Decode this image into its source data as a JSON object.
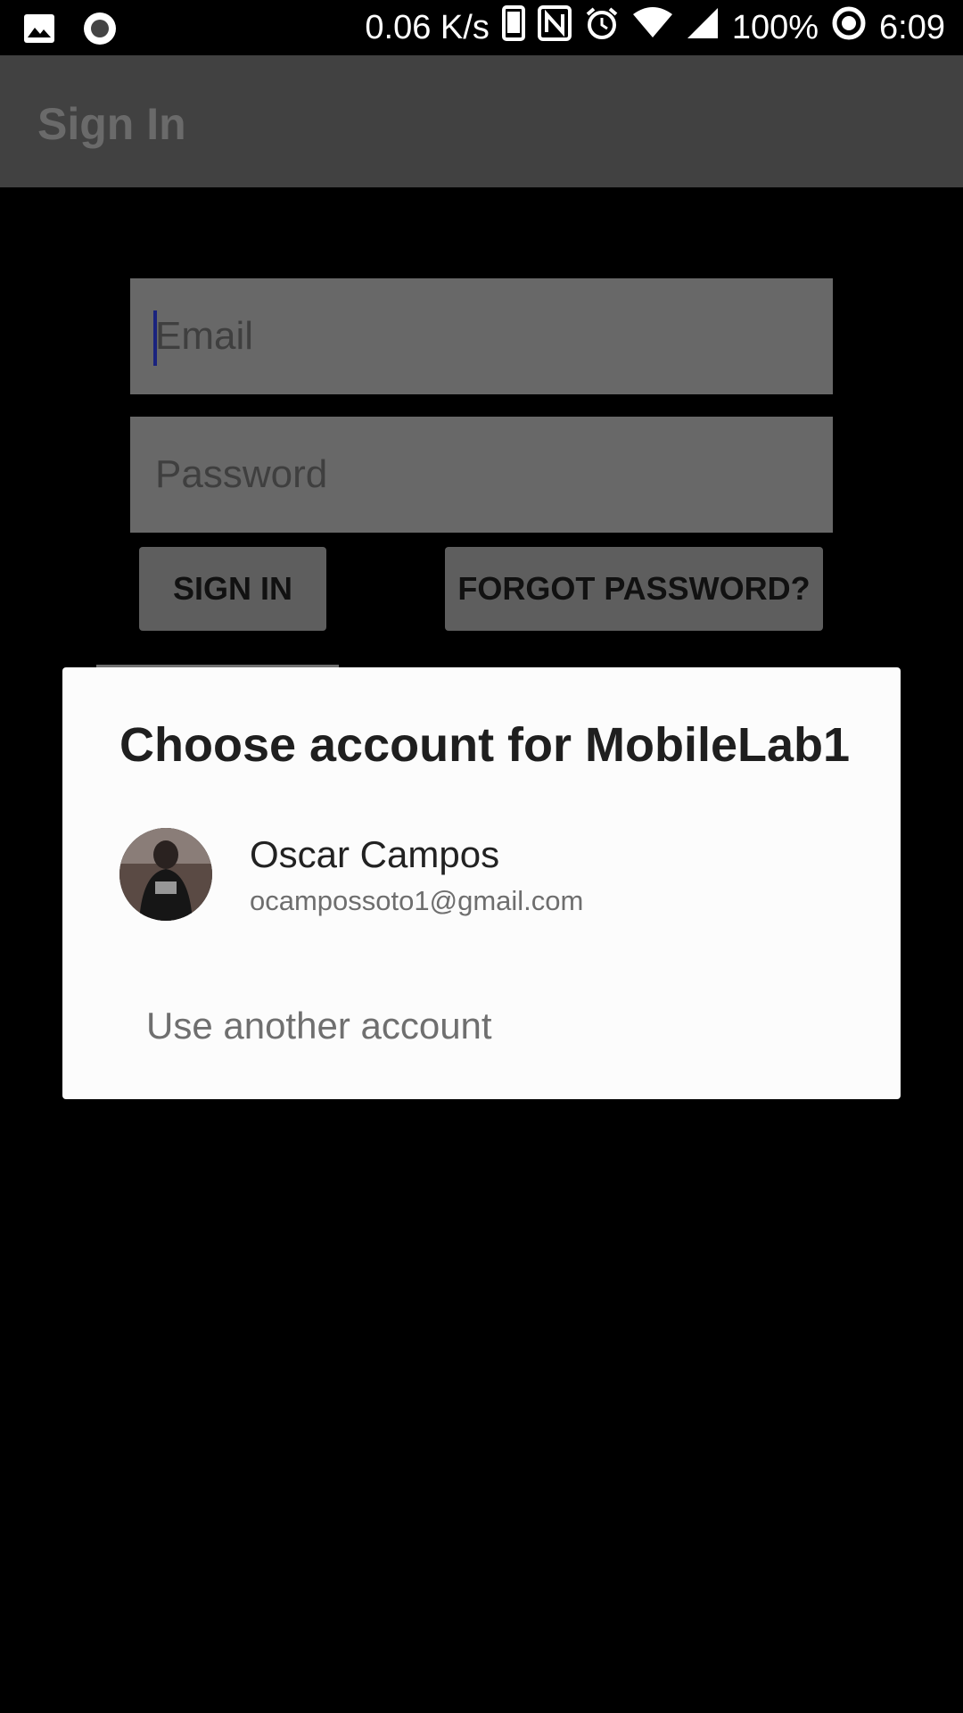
{
  "status_bar": {
    "network_speed": "0.06 K/s",
    "battery": "100%",
    "time": "6:09",
    "left_icons": [
      "image-icon",
      "record-icon"
    ],
    "right_icons": [
      "phone-icon",
      "nfc-icon",
      "alarm-icon",
      "wifi-icon",
      "signal-icon",
      "data-saver-icon"
    ]
  },
  "app_bar": {
    "title": "Sign In"
  },
  "form": {
    "email_placeholder": "Email",
    "password_placeholder": "Password",
    "sign_in_label": "SIGN IN",
    "forgot_password_label": "FORGOT PASSWORD?"
  },
  "dialog": {
    "title": "Choose account for MobileLab1",
    "account": {
      "name": "Oscar Campos",
      "email": "ocampossoto1@gmail.com"
    },
    "use_another_label": "Use another account"
  },
  "colors": {
    "app_bar": "#414141",
    "dialog_bg": "#fcfcfc",
    "field_bg": "#686868",
    "caret": "#1a237e"
  }
}
